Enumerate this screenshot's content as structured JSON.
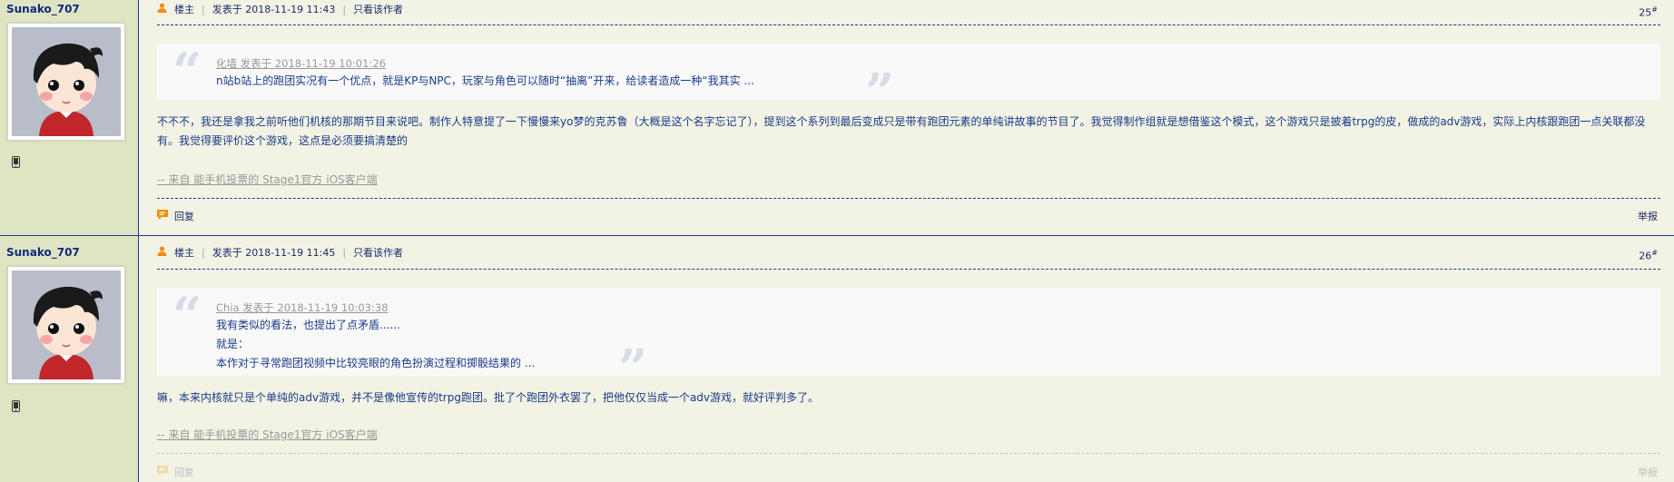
{
  "posts": [
    {
      "author": "Sunako_707",
      "role": "楼主",
      "posted": "发表于 2018-11-19 11:43",
      "only_author": "只看该作者",
      "floor_num": "25",
      "floor_sup": "#",
      "quote": {
        "header": "化墙 发表于 2018-11-19 10:01:26",
        "lines": [
          "n站b站上的跑团实况有一个优点，就是KP与NPC，玩家与角色可以随时“抽离”开来，给读者造成一种“我其实 ..."
        ]
      },
      "body": "不不不，我还是拿我之前听他们机核的那期节目来说吧。制作人特意提了一下慢慢来yo梦的克苏鲁（大概是这个名字忘记了），提到这个系列到最后变成只是带有跑团元素的单纯讲故事的节目了。我觉得制作组就是想借鉴这个模式，这个游戏只是披着trpg的皮，做成的adv游戏，实际上内核跟跑团一点关联都没有。我觉得要评价这个游戏，这点是必须要搞清楚的",
      "from": " -- 来自 能手机投票的 Stage1官方 iOS客户端",
      "reply": "回复",
      "report": "举报"
    },
    {
      "author": "Sunako_707",
      "role": "楼主",
      "posted": "发表于 2018-11-19 11:45",
      "only_author": "只看该作者",
      "floor_num": "26",
      "floor_sup": "#",
      "quote": {
        "header": "Chia 发表于 2018-11-19 10:03:38",
        "lines": [
          "我有类似的看法，也提出了点矛盾......",
          "就是：",
          "本作对于寻常跑团视频中比较亮眼的角色扮演过程和掷骰结果的 ..."
        ]
      },
      "body": "嘛，本来内核就只是个单纯的adv游戏，并不是像他宣传的trpg跑团。批了个跑团外衣罢了，把他仅仅当成一个adv游戏，就好评判多了。",
      "from": " -- 来自 能手机投票的 Stage1官方 iOS客户端",
      "reply": "回复",
      "report": "举报"
    }
  ],
  "icons": {
    "user": "user-icon",
    "phone": "mobile-phone-icon",
    "reply": "reply-bubble-icon",
    "quote_open": "open-quote-icon",
    "quote_close": "close-quote-icon"
  },
  "colors": {
    "background": "#f2f3e4",
    "sidebar": "#dfe5c3",
    "text_blue": "#1a3a8a",
    "border": "#1c3c8e",
    "accent_orange": "#f08c00",
    "muted": "#999999"
  }
}
